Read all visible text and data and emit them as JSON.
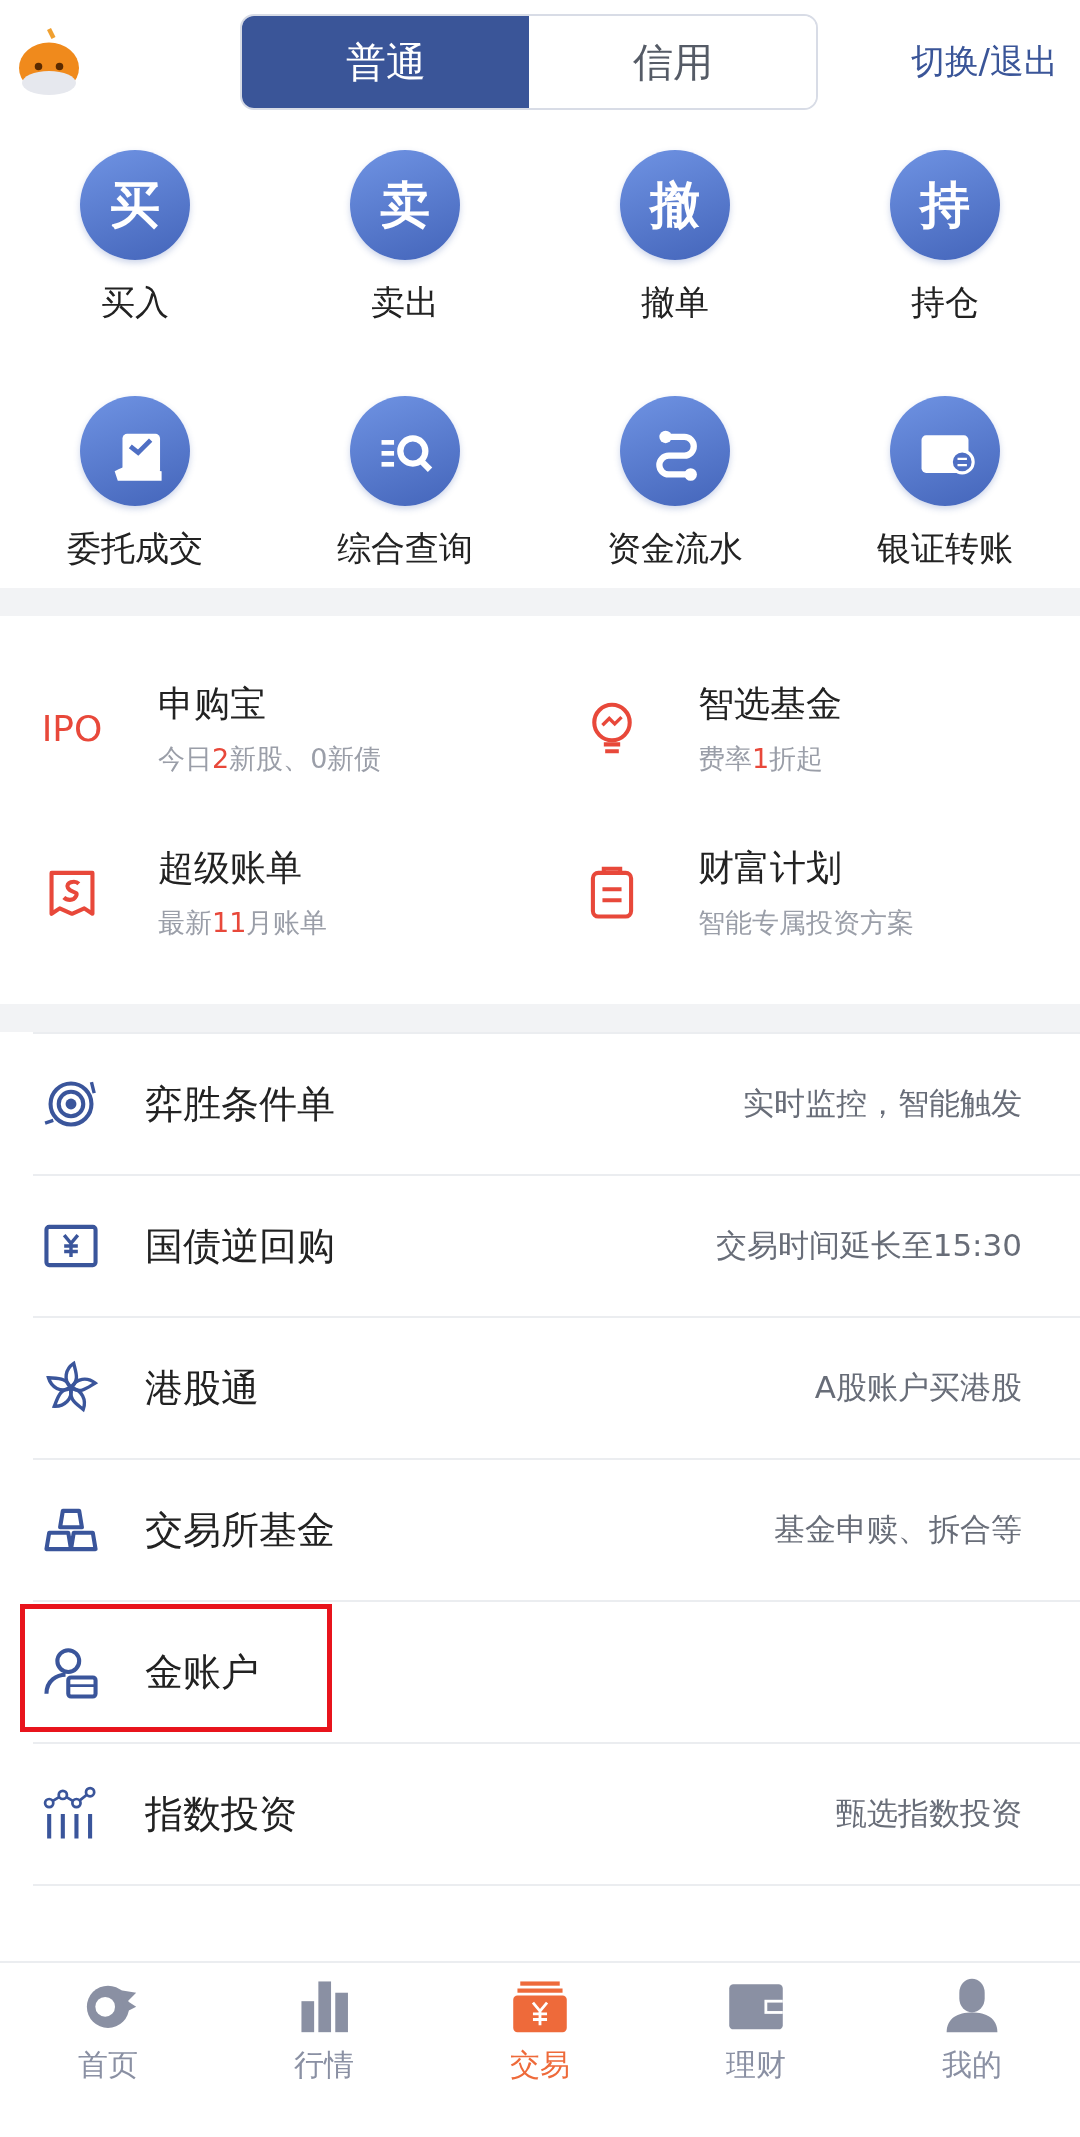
{
  "header": {
    "segments": [
      {
        "label": "普通",
        "selected": true
      },
      {
        "label": "信用",
        "selected": false
      }
    ],
    "switch_link": "切换/退出"
  },
  "actions": [
    {
      "kind": "glyph",
      "glyph": "买",
      "label": "买入"
    },
    {
      "kind": "glyph",
      "glyph": "卖",
      "label": "卖出"
    },
    {
      "kind": "glyph",
      "glyph": "撤",
      "label": "撤单"
    },
    {
      "kind": "glyph",
      "glyph": "持",
      "label": "持仓"
    },
    {
      "kind": "icon",
      "label": "委托成交"
    },
    {
      "kind": "icon",
      "label": "综合查询"
    },
    {
      "kind": "icon",
      "label": "资金流水"
    },
    {
      "kind": "icon",
      "label": "银证转账"
    }
  ],
  "features": [
    {
      "kind": "text",
      "icon_text": "IPO",
      "title": "申购宝",
      "subtitle": [
        {
          "text": "今日",
          "highlight": false
        },
        {
          "text": "2",
          "highlight": true
        },
        {
          "text": "新股、0新债",
          "highlight": false
        }
      ]
    },
    {
      "kind": "icon",
      "title": "智选基金",
      "subtitle": [
        {
          "text": "费率",
          "highlight": false
        },
        {
          "text": "1",
          "highlight": true
        },
        {
          "text": "折起",
          "highlight": false
        }
      ]
    },
    {
      "kind": "icon",
      "title": "超级账单",
      "subtitle": [
        {
          "text": "最新",
          "highlight": false
        },
        {
          "text": "11",
          "highlight": true
        },
        {
          "text": "月账单",
          "highlight": false
        }
      ]
    },
    {
      "kind": "icon",
      "title": "财富计划",
      "subtitle": [
        {
          "text": "智能专属投资方案",
          "highlight": false
        }
      ]
    }
  ],
  "services": [
    {
      "title": "弈胜条件单",
      "description": "实时监控，智能触发",
      "highlighted": false
    },
    {
      "title": "国债逆回购",
      "description": "交易时间延长至15:30",
      "highlighted": false
    },
    {
      "title": "港股通",
      "description": "A股账户买港股",
      "highlighted": false
    },
    {
      "title": "交易所基金",
      "description": "基金申赎、拆合等",
      "highlighted": false
    },
    {
      "title": "金账户",
      "highlighted": true
    },
    {
      "title": "指数投资",
      "description": "甄选指数投资",
      "highlighted": false
    }
  ],
  "tab_bar": [
    {
      "label": "首页",
      "selected": false
    },
    {
      "label": "行情",
      "selected": false
    },
    {
      "label": "交易",
      "selected": true
    },
    {
      "label": "理财",
      "selected": false
    },
    {
      "label": "我的",
      "selected": false
    }
  ]
}
